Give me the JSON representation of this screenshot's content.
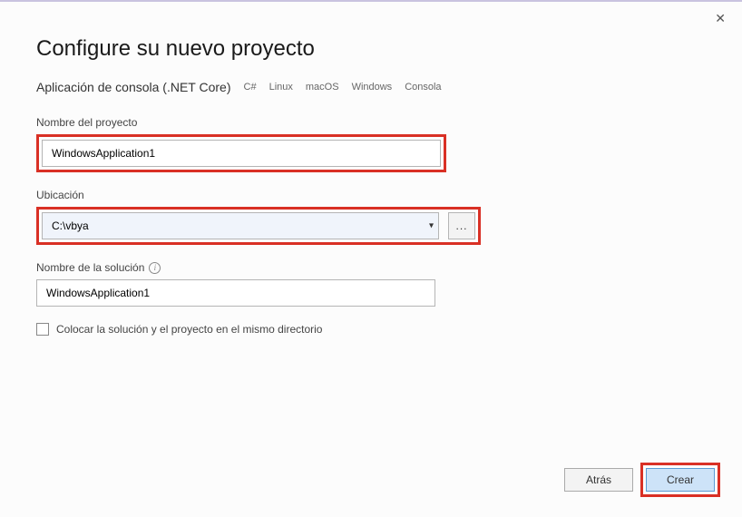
{
  "title": "Configure su nuevo proyecto",
  "subtitle": "Aplicación de consola (.NET Core)",
  "tags": [
    "C#",
    "Linux",
    "macOS",
    "Windows",
    "Consola"
  ],
  "fields": {
    "project_name": {
      "label": "Nombre del proyecto",
      "value": "WindowsApplication1"
    },
    "location": {
      "label": "Ubicación",
      "value": "C:\\vbya"
    },
    "solution_name": {
      "label": "Nombre de la solución",
      "value": "WindowsApplication1"
    }
  },
  "browse_button": "...",
  "checkbox_label": "Colocar la solución y el proyecto en el mismo directorio",
  "buttons": {
    "back": "Atrás",
    "create": "Crear"
  },
  "close_symbol": "✕"
}
